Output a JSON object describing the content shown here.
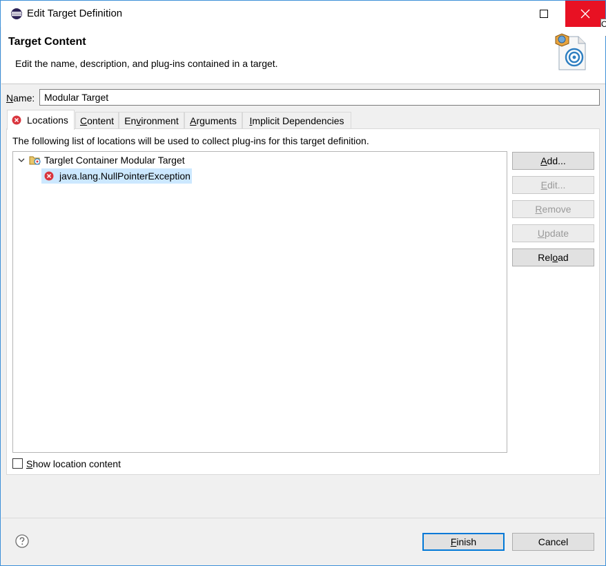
{
  "window": {
    "title": "Edit Target Definition",
    "tooltip_peek": "C"
  },
  "banner": {
    "title": "Target Content",
    "description": "Edit the name, description, and plug-ins contained in a target."
  },
  "name_field": {
    "label_mn": "N",
    "label_rest": "ame:",
    "value": "Modular Target"
  },
  "tabs": [
    {
      "label": "Locations",
      "active": true,
      "has_error_icon": true
    },
    {
      "mn": "C",
      "rest": "ontent"
    },
    {
      "pre": "En",
      "mn": "v",
      "rest": "ironment"
    },
    {
      "mn": "A",
      "rest": "rguments"
    },
    {
      "mn": "I",
      "rest": "mplicit Dependencies"
    }
  ],
  "locations": {
    "description": "The following list of locations will be used to collect plug-ins for this target definition.",
    "tree": [
      {
        "label": "Targlet Container Modular Target",
        "expanded": true,
        "icon": "target-container-icon",
        "children": [
          {
            "label": "java.lang.NullPointerException",
            "icon": "error-icon",
            "selected": true
          }
        ]
      }
    ]
  },
  "buttons": {
    "add": {
      "mn": "A",
      "rest": "dd...",
      "enabled": true
    },
    "edit": {
      "mn": "E",
      "rest": "dit...",
      "enabled": false
    },
    "remove": {
      "mn": "R",
      "rest": "emove",
      "enabled": false
    },
    "update": {
      "mn": "U",
      "rest": "pdate",
      "enabled": false
    },
    "reload": {
      "pre": "Rel",
      "mn": "o",
      "rest": "ad",
      "enabled": true
    }
  },
  "show_location_content": {
    "mn": "S",
    "rest": "how location content",
    "checked": false
  },
  "footer": {
    "finish": {
      "mn": "F",
      "rest": "inish"
    },
    "cancel": {
      "label": "Cancel"
    }
  },
  "colors": {
    "accent": "#0078d7",
    "close_red": "#e81123",
    "selection": "#cce8ff",
    "error": "#d9363e"
  }
}
